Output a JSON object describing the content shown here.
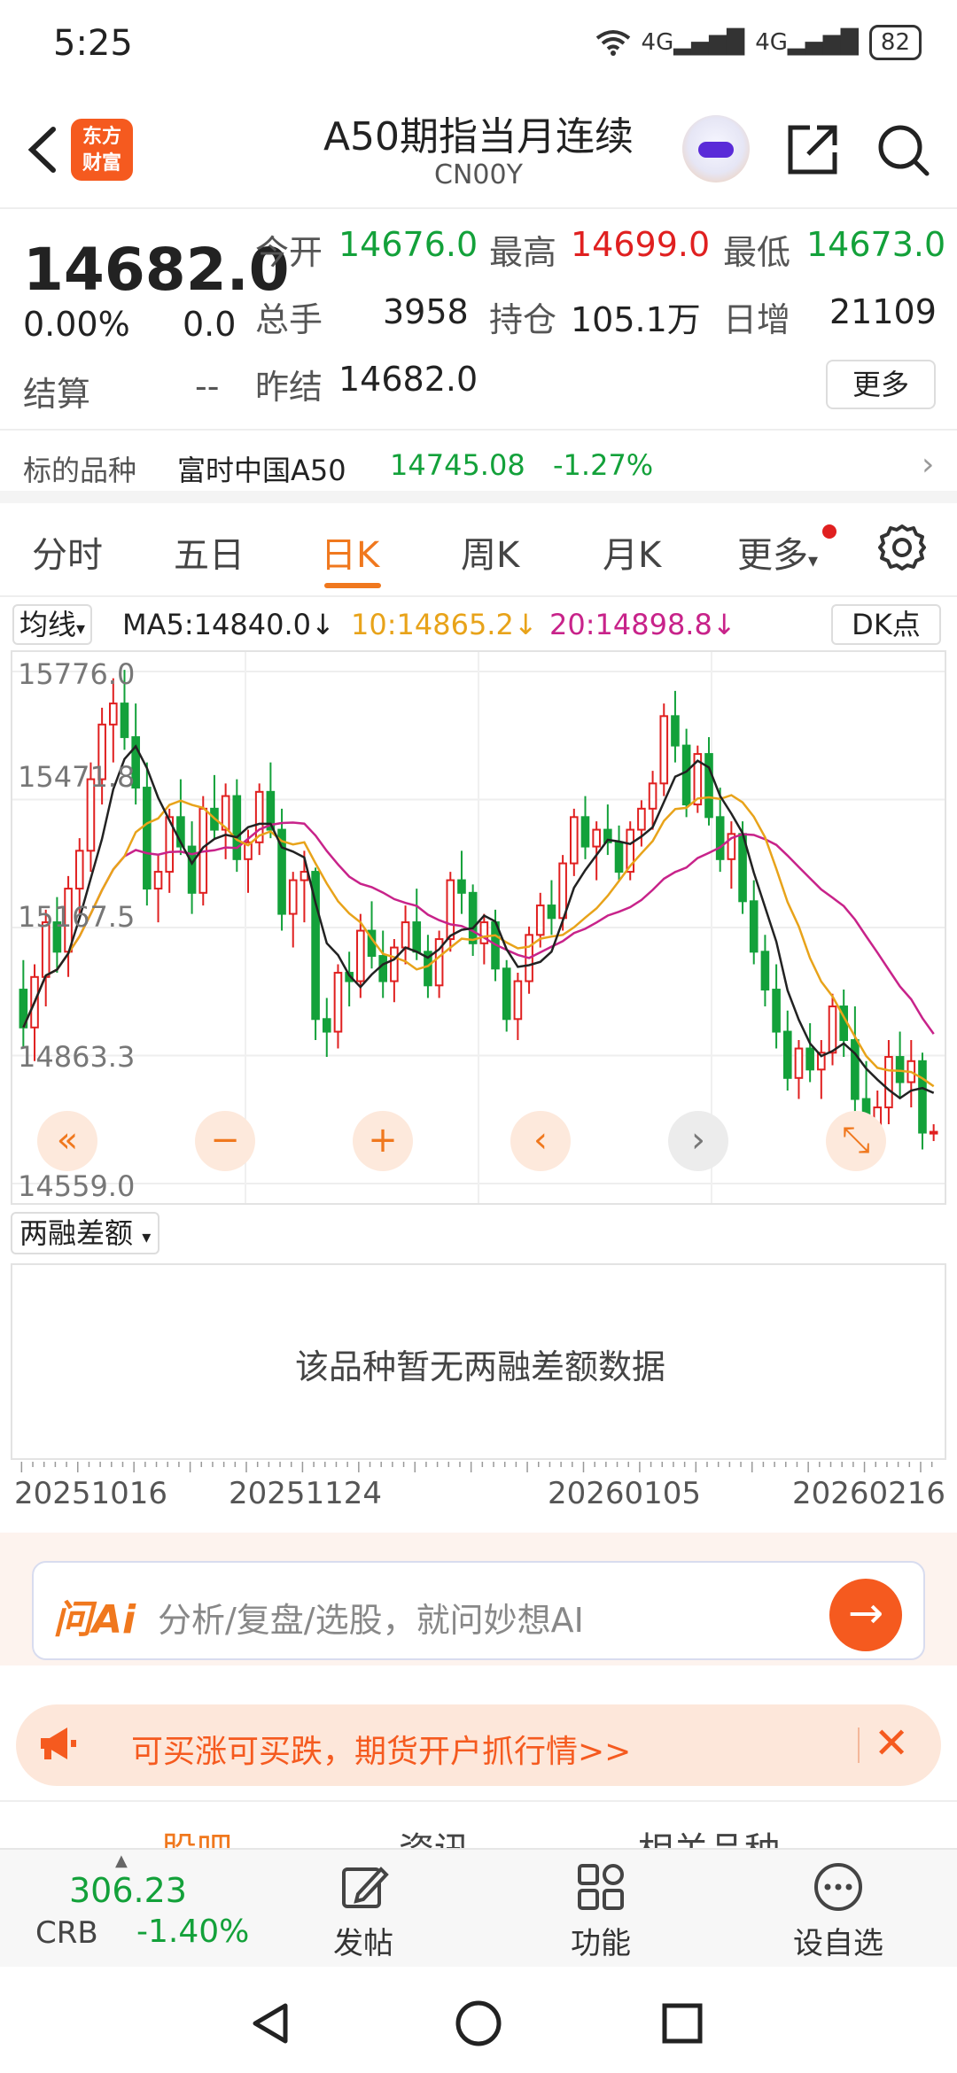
{
  "status_bar": {
    "time": "5:25",
    "network1": "4G",
    "network2": "4G",
    "battery": "82"
  },
  "header": {
    "title": "A50期指当月连续",
    "subtitle": "CN00Y",
    "brand_line1": "东方",
    "brand_line2": "财富"
  },
  "quote": {
    "price": "14682.0",
    "change_pct": "0.00%",
    "change_abs": "0.0",
    "open_label": "今开",
    "open": "14676.0",
    "high_label": "最高",
    "high": "14699.0",
    "low_label": "最低",
    "low": "14673.0",
    "volume_label": "总手",
    "volume": "3958",
    "oi_label": "持仓",
    "oi": "105.1万",
    "oi_chg_label": "日增",
    "oi_chg": "21109",
    "settle_label": "结算",
    "settle": "--",
    "prev_settle_label": "昨结",
    "prev_settle": "14682.0",
    "more_label": "更多"
  },
  "underlying": {
    "label": "标的品种",
    "name": "富时中国A50",
    "price": "14745.08",
    "change_pct": "-1.27%"
  },
  "tabs": [
    {
      "label": "分时"
    },
    {
      "label": "五日"
    },
    {
      "label": "日K"
    },
    {
      "label": "周K"
    },
    {
      "label": "月K"
    },
    {
      "label": "更多"
    }
  ],
  "ma_row": {
    "select_label": "均线",
    "ma5": "MA5:14840.0↓",
    "ma10": "10:14865.2↓",
    "ma20": "20:14898.8↓",
    "dk_label": "DK点"
  },
  "chart_data": {
    "type": "candlestick",
    "y_ticks": [
      "15776.0",
      "15471.8",
      "15167.5",
      "14863.3",
      "14559.0"
    ],
    "ylim": [
      14559.0,
      15776.0
    ],
    "x_tick_labels": [
      "20251016",
      "20251124",
      "20260105",
      "20260216"
    ],
    "up_color": "#e02020",
    "down_color": "#13a13a",
    "ma_colors": {
      "ma5": "#222222",
      "ma10": "#e8a31a",
      "ma20": "#c8238a"
    },
    "candles": [
      [
        15020,
        15090,
        14880,
        14930
      ],
      [
        14930,
        15080,
        14850,
        15050
      ],
      [
        15050,
        15210,
        14980,
        15180
      ],
      [
        15180,
        15240,
        15060,
        15110
      ],
      [
        15110,
        15290,
        15050,
        15260
      ],
      [
        15260,
        15380,
        15200,
        15350
      ],
      [
        15350,
        15560,
        15300,
        15520
      ],
      [
        15520,
        15690,
        15460,
        15650
      ],
      [
        15650,
        15760,
        15560,
        15700
      ],
      [
        15700,
        15780,
        15590,
        15620
      ],
      [
        15620,
        15700,
        15460,
        15500
      ],
      [
        15500,
        15560,
        15220,
        15260
      ],
      [
        15260,
        15340,
        15180,
        15300
      ],
      [
        15300,
        15450,
        15250,
        15430
      ],
      [
        15430,
        15520,
        15340,
        15360
      ],
      [
        15360,
        15420,
        15200,
        15250
      ],
      [
        15250,
        15480,
        15220,
        15450
      ],
      [
        15450,
        15530,
        15380,
        15400
      ],
      [
        15400,
        15510,
        15330,
        15480
      ],
      [
        15480,
        15520,
        15300,
        15330
      ],
      [
        15330,
        15400,
        15250,
        15370
      ],
      [
        15370,
        15510,
        15340,
        15490
      ],
      [
        15490,
        15560,
        15380,
        15400
      ],
      [
        15400,
        15450,
        15160,
        15200
      ],
      [
        15200,
        15300,
        15120,
        15280
      ],
      [
        15280,
        15350,
        15180,
        15300
      ],
      [
        15300,
        15310,
        14900,
        14950
      ],
      [
        14950,
        15000,
        14860,
        14920
      ],
      [
        14920,
        15080,
        14880,
        15060
      ],
      [
        15060,
        15110,
        14980,
        15040
      ],
      [
        15040,
        15200,
        15000,
        15160
      ],
      [
        15160,
        15230,
        15070,
        15100
      ],
      [
        15100,
        15160,
        15000,
        15040
      ],
      [
        15040,
        15140,
        14990,
        15120
      ],
      [
        15120,
        15220,
        15080,
        15180
      ],
      [
        15180,
        15260,
        15090,
        15110
      ],
      [
        15110,
        15150,
        15000,
        15030
      ],
      [
        15030,
        15160,
        15000,
        15140
      ],
      [
        15140,
        15300,
        15110,
        15280
      ],
      [
        15280,
        15350,
        15200,
        15250
      ],
      [
        15250,
        15270,
        15100,
        15130
      ],
      [
        15130,
        15200,
        15080,
        15180
      ],
      [
        15180,
        15210,
        15040,
        15070
      ],
      [
        15070,
        15090,
        14920,
        14950
      ],
      [
        14950,
        15060,
        14900,
        15040
      ],
      [
        15040,
        15170,
        15010,
        15150
      ],
      [
        15150,
        15250,
        15120,
        15220
      ],
      [
        15220,
        15280,
        15150,
        15190
      ],
      [
        15190,
        15340,
        15160,
        15320
      ],
      [
        15320,
        15450,
        15290,
        15430
      ],
      [
        15430,
        15480,
        15330,
        15360
      ],
      [
        15360,
        15420,
        15280,
        15400
      ],
      [
        15400,
        15460,
        15340,
        15370
      ],
      [
        15370,
        15410,
        15280,
        15300
      ],
      [
        15300,
        15420,
        15280,
        15400
      ],
      [
        15400,
        15470,
        15360,
        15450
      ],
      [
        15450,
        15540,
        15400,
        15510
      ],
      [
        15510,
        15700,
        15480,
        15670
      ],
      [
        15670,
        15730,
        15560,
        15600
      ],
      [
        15600,
        15640,
        15430,
        15460
      ],
      [
        15460,
        15600,
        15440,
        15580
      ],
      [
        15580,
        15620,
        15410,
        15430
      ],
      [
        15430,
        15500,
        15300,
        15330
      ],
      [
        15330,
        15420,
        15260,
        15390
      ],
      [
        15390,
        15420,
        15200,
        15230
      ],
      [
        15230,
        15280,
        15080,
        15110
      ],
      [
        15110,
        15150,
        14980,
        15020
      ],
      [
        15020,
        15080,
        14880,
        14920
      ],
      [
        14920,
        14970,
        14780,
        14810
      ],
      [
        14810,
        14900,
        14760,
        14880
      ],
      [
        14880,
        14940,
        14800,
        14830
      ],
      [
        14830,
        14900,
        14760,
        14870
      ],
      [
        14870,
        15010,
        14840,
        14980
      ],
      [
        14980,
        15020,
        14860,
        14900
      ],
      [
        14900,
        14980,
        14720,
        14760
      ],
      [
        14760,
        14850,
        14600,
        14650
      ],
      [
        14650,
        14780,
        14620,
        14740
      ],
      [
        14740,
        14900,
        14700,
        14860
      ],
      [
        14860,
        14920,
        14760,
        14800
      ],
      [
        14800,
        14900,
        14740,
        14850
      ],
      [
        14850,
        14870,
        14640,
        14680
      ],
      [
        14680,
        14700,
        14660,
        14682
      ]
    ]
  },
  "chart_controls": {
    "first": "«",
    "zoom_out": "−",
    "zoom_in": "+",
    "prev": "‹",
    "next": "›",
    "expand": "⤡"
  },
  "margin": {
    "select_label": "两融差额",
    "empty_text": "该品种暂无两融差额数据"
  },
  "ai": {
    "logo": "问Ai",
    "placeholder": "分析/复盘/选股，就问妙想AI",
    "go": "→"
  },
  "promo": {
    "text": "可买涨可买跌，期货开户抓行情>>",
    "close": "✕"
  },
  "peek_tabs": [
    "股吧",
    "资讯",
    "相关品种"
  ],
  "bottom_bar": {
    "crb_value": "306.23",
    "crb_name": "CRB",
    "crb_pct": "-1.40%",
    "post_label": "发帖",
    "func_label": "功能",
    "fav_label": "设自选"
  }
}
